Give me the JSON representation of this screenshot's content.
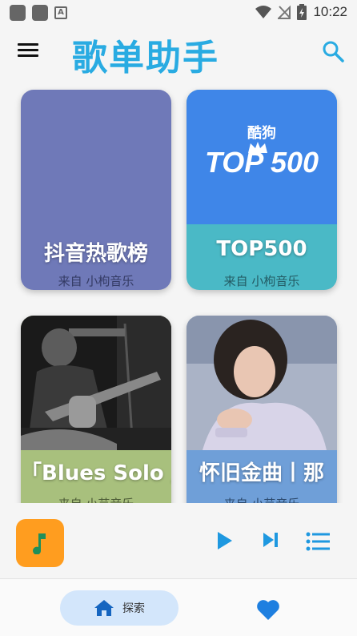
{
  "status_bar": {
    "time": "10:22",
    "notification_icon": "A"
  },
  "app_bar": {
    "title": "歌单助手"
  },
  "playlists": [
    {
      "title": "抖音热歌榜",
      "source": "来自 小枸音乐"
    },
    {
      "title": "TOP500",
      "source": "来自 小枸音乐",
      "cover_brand": "酷狗",
      "cover_text": "TOP 500"
    },
    {
      "title": "「Blues Solo 」",
      "source": "来自 小芸音乐"
    },
    {
      "title": "怀旧金曲丨那",
      "source": "来自 小芸音乐"
    }
  ],
  "bottom_nav": {
    "explore_label": "探索"
  },
  "colors": {
    "accent": "#29abe2",
    "player_art": "#ff9d1f",
    "nav_pill": "#d3e6fb"
  }
}
